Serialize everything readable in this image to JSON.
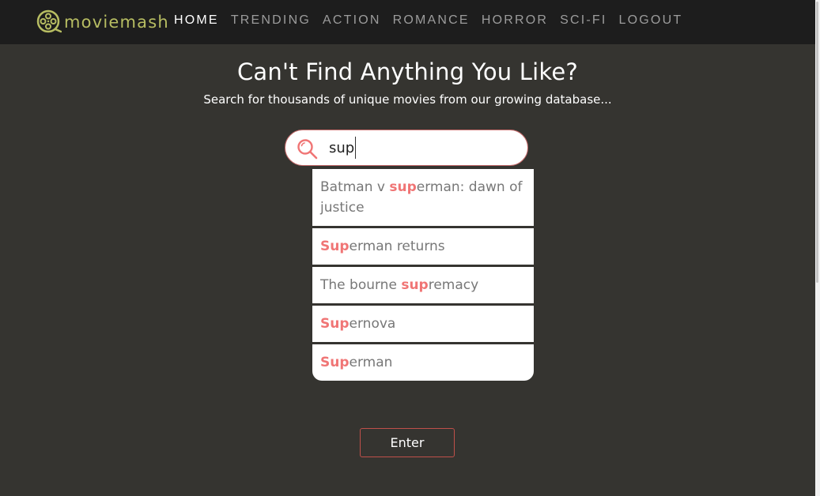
{
  "brand": {
    "name": "moviemash",
    "accent": "#b7bd62"
  },
  "nav": {
    "items": [
      {
        "label": "HOME",
        "active": true
      },
      {
        "label": "TRENDING"
      },
      {
        "label": "ACTION"
      },
      {
        "label": "ROMANCE"
      },
      {
        "label": "HORROR"
      },
      {
        "label": "SCI-FI"
      },
      {
        "label": "LOGOUT"
      }
    ]
  },
  "hero": {
    "title": "Can't Find Anything You Like?",
    "subtitle": "Search for thousands of unique movies from our growing database..."
  },
  "search": {
    "value": "sup",
    "icon": "search-icon",
    "icon_color": "#f07575"
  },
  "suggestions": [
    {
      "before": "Batman v ",
      "match": "sup",
      "after": "erman: dawn of justice"
    },
    {
      "before": "",
      "match": "Sup",
      "after": "erman returns"
    },
    {
      "before": "The bourne ",
      "match": "sup",
      "after": "remacy"
    },
    {
      "before": "",
      "match": "Sup",
      "after": "ernova"
    },
    {
      "before": "",
      "match": "Sup",
      "after": "erman"
    }
  ],
  "enter_button": {
    "label": "Enter"
  },
  "colors": {
    "background": "#353430",
    "navbar": "#1d1d1d",
    "highlight": "#f07575",
    "button_border": "#c0504a"
  }
}
